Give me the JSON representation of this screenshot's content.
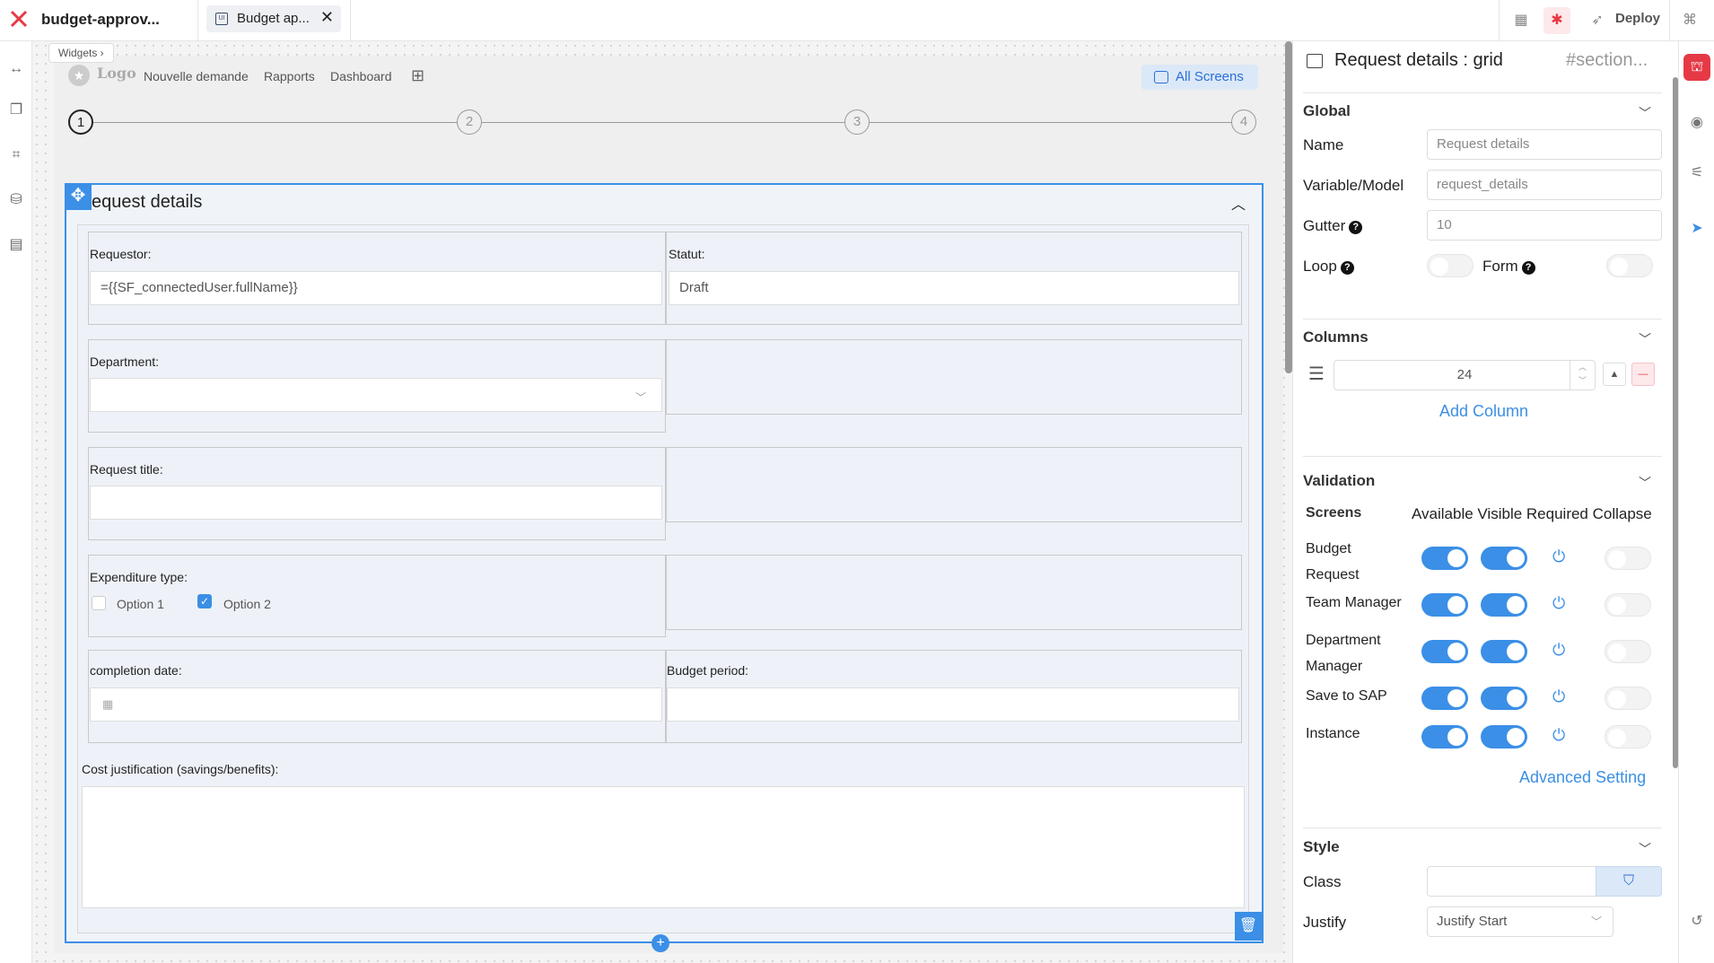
{
  "app": {
    "title": "budget-approv..."
  },
  "tab": {
    "label": "Budget ap...",
    "close": "✕"
  },
  "toolbar": {
    "deploy_label": "Deploy"
  },
  "canvas": {
    "widgets_pill": "Widgets ›",
    "nav": {
      "logo_text": "Logo",
      "items": [
        "Nouvelle demande",
        "Rapports",
        "Dashboard"
      ],
      "all_screens": "All Screens"
    },
    "steps": [
      "1",
      "2",
      "3",
      "4"
    ],
    "section": {
      "title": "equest details",
      "fields": {
        "requestor_label": "Requestor:",
        "requestor_value": "={{SF_connectedUser.fullName}}",
        "statut_label": "Statut:",
        "statut_value": "Draft",
        "department_label": "Department:",
        "request_title_label": "Request title:",
        "expenditure_label": "Expenditure type:",
        "option1": "Option 1",
        "option2": "Option 2",
        "completion_label": "completion date:",
        "budget_period_label": "Budget period:",
        "cost_label": "Cost justification (savings/benefits):"
      }
    }
  },
  "panel": {
    "title": "Request details : grid",
    "hash": "#section...",
    "global": {
      "heading": "Global",
      "name_label": "Name",
      "name_placeholder": "Request details",
      "variable_label": "Variable/Model",
      "variable_placeholder": "request_details",
      "gutter_label": "Gutter",
      "gutter_placeholder": "10",
      "loop_label": "Loop",
      "form_label": "Form"
    },
    "columns": {
      "heading": "Columns",
      "value": "24",
      "add_label": "Add Column"
    },
    "validation": {
      "heading": "Validation",
      "screens_label": "Screens",
      "col_headers": "Available Visible Required Collapse",
      "rows": [
        {
          "name1": "Budget",
          "name2": "Request"
        },
        {
          "name1": "Team Manager",
          "name2": ""
        },
        {
          "name1": "Department",
          "name2": "Manager"
        },
        {
          "name1": "Save to SAP",
          "name2": ""
        },
        {
          "name1": "Instance",
          "name2": ""
        }
      ],
      "advanced_label": "Advanced Setting"
    },
    "style": {
      "heading": "Style",
      "class_label": "Class",
      "justify_label": "Justify",
      "justify_value": "Justify Start"
    }
  },
  "colors": {
    "accent": "#3b8fe6",
    "danger": "#e63946"
  },
  "icons": [
    "close-icon",
    "grid-icon",
    "swap-icon",
    "layers-icon",
    "flow-icon",
    "database-icon",
    "clipboard-icon",
    "eye-icon",
    "sliders-icon",
    "cursor-icon",
    "history-icon",
    "power-icon",
    "trash-icon",
    "move-icon",
    "calendar-icon",
    "rocket-icon"
  ]
}
